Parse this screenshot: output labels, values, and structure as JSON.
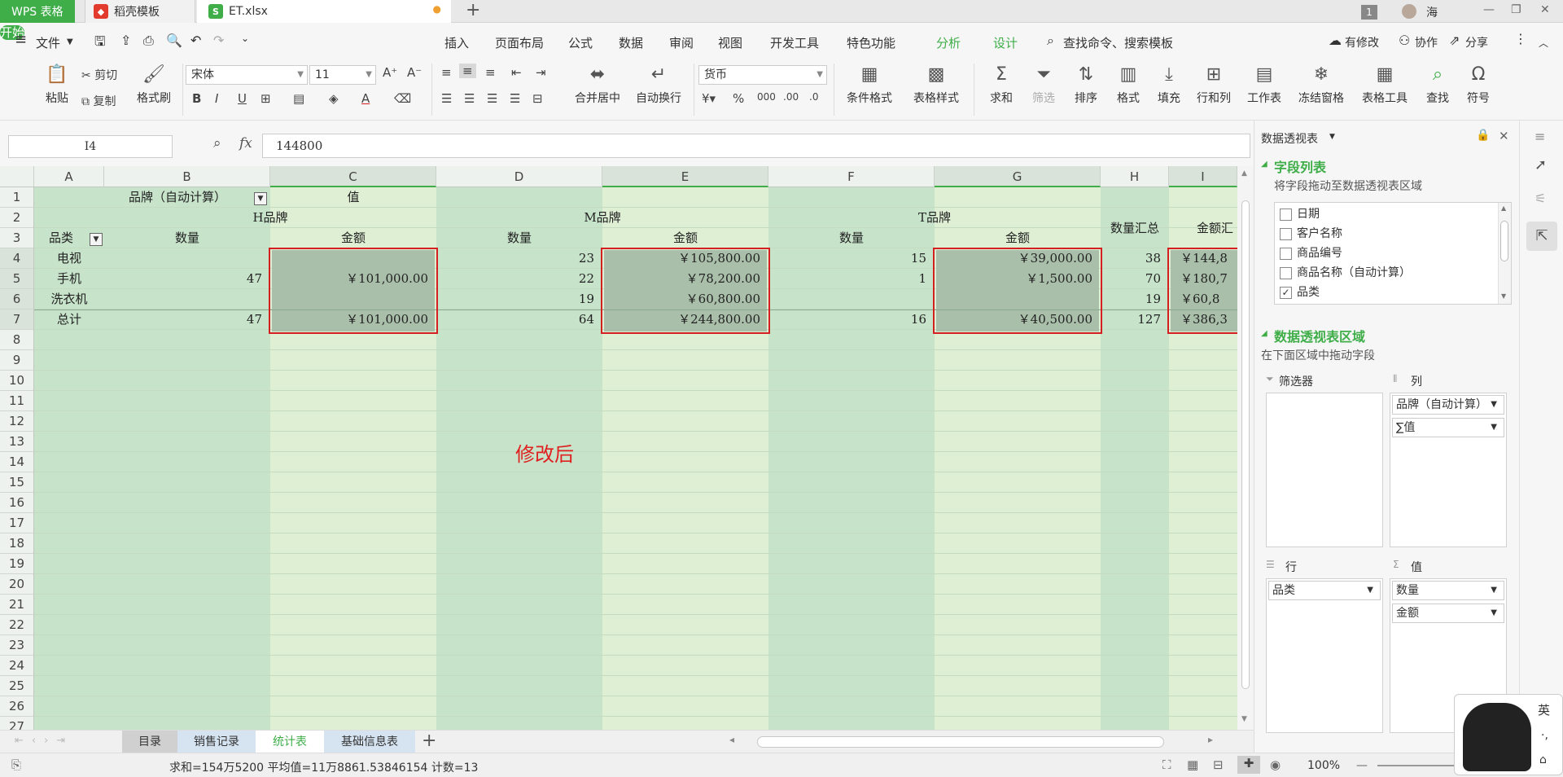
{
  "titlebar": {
    "app_tab": "WPS 表格",
    "template_tab": "稻壳模板",
    "file_tab": "ET.xlsx",
    "new_tab": "+",
    "window_count": "1",
    "user_name": "海"
  },
  "menubar": {
    "file": "文件",
    "items": [
      "开始",
      "插入",
      "页面布局",
      "公式",
      "数据",
      "审阅",
      "视图",
      "开发工具",
      "特色功能",
      "分析",
      "设计"
    ],
    "search": "查找命令、搜索模板",
    "modified": "有修改",
    "collab": "协作",
    "share": "分享"
  },
  "ribbon": {
    "paste": "粘贴",
    "cut": "剪切",
    "copy": "复制",
    "format_painter": "格式刷",
    "font_name": "宋体",
    "font_size": "11",
    "merge_center": "合并居中",
    "wrap_text": "自动换行",
    "number_format": "货币",
    "cond_format": "条件格式",
    "table_style": "表格样式",
    "sum": "求和",
    "filter": "筛选",
    "sort": "排序",
    "format": "格式",
    "fill": "填充",
    "row_col": "行和列",
    "worksheet": "工作表",
    "freeze": "冻结窗格",
    "table_tools": "表格工具",
    "find": "查找",
    "symbol": "符号"
  },
  "formula_bar": {
    "name_box": "I4",
    "fx": "fx",
    "value": "144800"
  },
  "grid": {
    "columns": [
      "A",
      "B",
      "C",
      "D",
      "E",
      "F",
      "G",
      "H",
      "I"
    ],
    "rows": [
      "1",
      "2",
      "3",
      "4",
      "5",
      "6",
      "7",
      "8",
      "9",
      "10",
      "11",
      "12",
      "13",
      "14",
      "15",
      "16",
      "17",
      "18",
      "19",
      "20",
      "21",
      "22",
      "23",
      "24",
      "25",
      "26",
      "27"
    ],
    "pivot": {
      "col_field": "品牌（自动计算）",
      "values_label": "值",
      "brand_h": "H品牌",
      "brand_m": "M品牌",
      "brand_t": "T品牌",
      "qty_total": "数量汇总",
      "amt_total": "金额汇",
      "row_field": "品类",
      "qty": "数量",
      "amt": "金额",
      "rows": [
        {
          "label": "电视",
          "h_qty": "",
          "h_amt": "",
          "m_qty": "23",
          "m_amt": "￥105,800.00",
          "t_qty": "15",
          "t_amt": "￥39,000.00",
          "qty_total": "38",
          "amt_total": "￥144,8"
        },
        {
          "label": "手机",
          "h_qty": "47",
          "h_amt": "￥101,000.00",
          "m_qty": "22",
          "m_amt": "￥78,200.00",
          "t_qty": "1",
          "t_amt": "￥1,500.00",
          "qty_total": "70",
          "amt_total": "￥180,7"
        },
        {
          "label": "洗衣机",
          "h_qty": "",
          "h_amt": "",
          "m_qty": "19",
          "m_amt": "￥60,800.00",
          "t_qty": "",
          "t_amt": "",
          "qty_total": "19",
          "amt_total": "￥60,8"
        },
        {
          "label": "总计",
          "h_qty": "47",
          "h_amt": "￥101,000.00",
          "m_qty": "64",
          "m_amt": "￥244,800.00",
          "t_qty": "16",
          "t_amt": "￥40,500.00",
          "qty_total": "127",
          "amt_total": "￥386,3"
        }
      ]
    },
    "annotation": "修改后"
  },
  "sheets": {
    "tabs": [
      "目录",
      "销售记录",
      "统计表",
      "基础信息表"
    ],
    "active": "统计表",
    "add": "+"
  },
  "status": {
    "summary": "求和=154万5200  平均值=11万8861.53846154  计数=13",
    "zoom": "100%"
  },
  "pivot_pane": {
    "title": "数据透视表",
    "field_list": "字段列表",
    "field_hint": "将字段拖动至数据透视表区域",
    "fields": [
      {
        "label": "日期",
        "checked": false
      },
      {
        "label": "客户名称",
        "checked": false
      },
      {
        "label": "商品编号",
        "checked": false
      },
      {
        "label": "商品名称（自动计算）",
        "checked": false
      },
      {
        "label": "品类",
        "checked": true
      }
    ],
    "areas_title": "数据透视表区域",
    "areas_hint": "在下面区域中拖动字段",
    "filter_label": "筛选器",
    "col_label": "列",
    "row_label": "行",
    "val_label": "值",
    "col_items": [
      "品牌（自动计算）",
      "∑值"
    ],
    "row_items": [
      "品类"
    ],
    "val_items": [
      "数量",
      "金额"
    ]
  },
  "ime": {
    "lang": "英"
  },
  "colors": {
    "accent": "#3fae49",
    "sheet_bg": "#dfefd4",
    "highlight": "#d42020"
  }
}
